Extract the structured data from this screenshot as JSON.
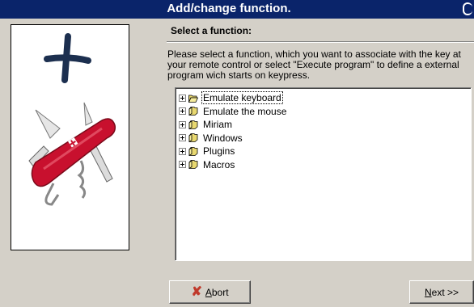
{
  "window": {
    "title": "Add/change function."
  },
  "page": {
    "heading": "Select a function:",
    "description": "Please select a function, which you want to associate with the key at your remote control or select \"Execute program\" to define a external program wich starts on keypress."
  },
  "tree": {
    "items": [
      {
        "label": "Emulate keyboard",
        "selected": true,
        "open": true
      },
      {
        "label": "Emulate the mouse",
        "selected": false,
        "open": false
      },
      {
        "label": "Miriam",
        "selected": false,
        "open": false
      },
      {
        "label": "Windows",
        "selected": false,
        "open": false
      },
      {
        "label": "Plugins",
        "selected": false,
        "open": false
      },
      {
        "label": "Macros",
        "selected": false,
        "open": false
      }
    ]
  },
  "buttons": {
    "abort": {
      "accel": "A",
      "rest": "bort"
    },
    "next": {
      "accel": "N",
      "rest": "ext",
      "suffix": ">>"
    }
  },
  "colors": {
    "titlebar": "#0a246a",
    "dialog": "#d4d0c8",
    "folder": "#e8d870",
    "knife_red": "#c8102e"
  }
}
